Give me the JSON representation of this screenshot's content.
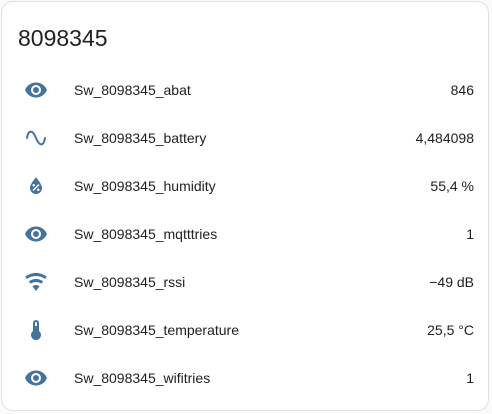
{
  "card": {
    "title": "8098345"
  },
  "colors": {
    "icon": "#44739e",
    "text": "#212121",
    "border": "#e0e0e0"
  },
  "entities": [
    {
      "icon": "eye-icon",
      "name": "Sw_8098345_abat",
      "value": "846"
    },
    {
      "icon": "sine-wave-icon",
      "name": "Sw_8098345_battery",
      "value": "4,484098"
    },
    {
      "icon": "water-percent-icon",
      "name": "Sw_8098345_humidity",
      "value": "55,4 %"
    },
    {
      "icon": "eye-icon",
      "name": "Sw_8098345_mqtttries",
      "value": "1"
    },
    {
      "icon": "wifi-icon",
      "name": "Sw_8098345_rssi",
      "value": "−49 dB"
    },
    {
      "icon": "thermometer-icon",
      "name": "Sw_8098345_temperature",
      "value": "25,5 °C"
    },
    {
      "icon": "eye-icon",
      "name": "Sw_8098345_wifitries",
      "value": "1"
    }
  ]
}
